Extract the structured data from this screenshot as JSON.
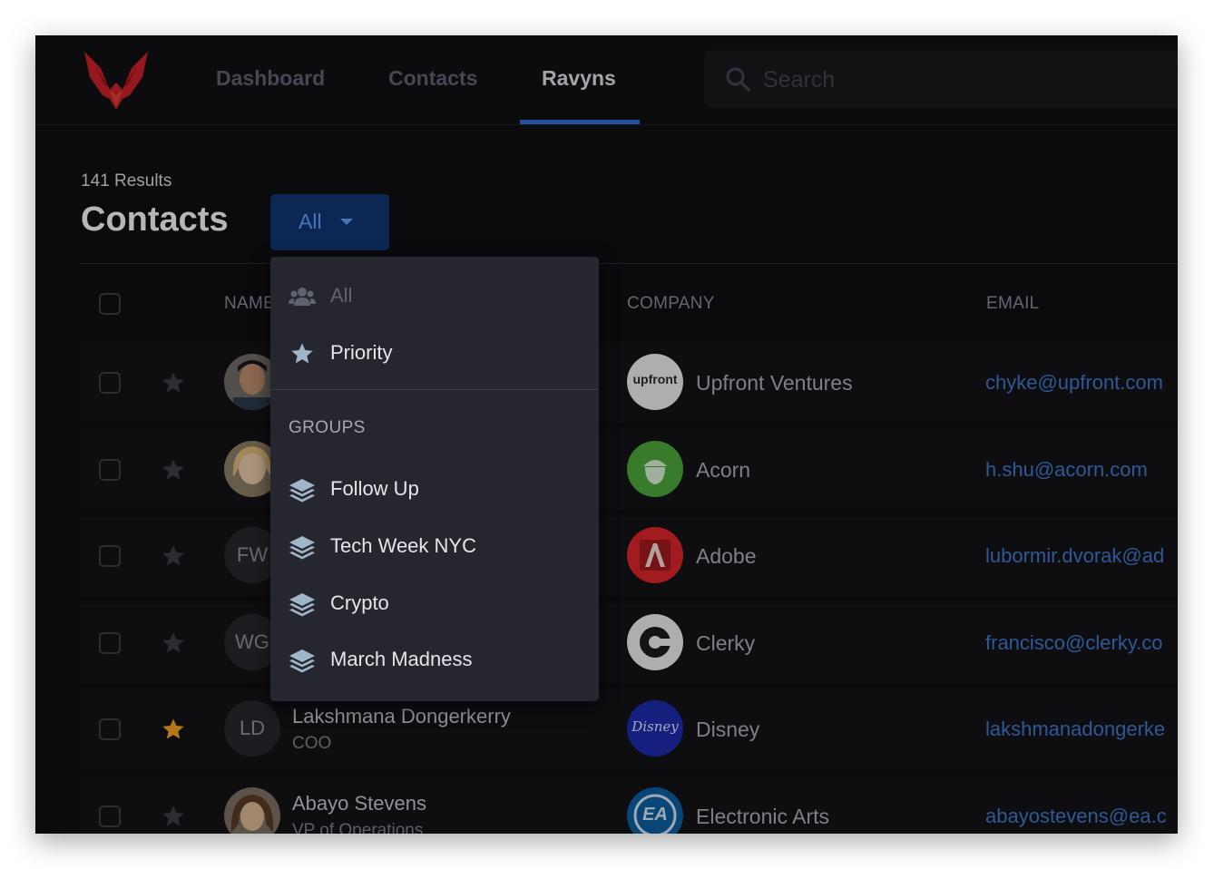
{
  "nav": {
    "tabs": [
      {
        "label": "Dashboard"
      },
      {
        "label": "Contacts"
      },
      {
        "label": "Ravyns"
      }
    ],
    "active_tab": "Ravyns",
    "search_placeholder": "Search"
  },
  "header": {
    "results_count": "141 Results",
    "title": "Contacts",
    "filter_label": "All"
  },
  "columns": {
    "name": "NAME",
    "company": "COMPANY",
    "email": "EMAIL"
  },
  "rows": [
    {
      "initials": "",
      "name": "",
      "title": "",
      "company": "Upfront Ventures",
      "company_logo_text": "upfront",
      "email": "chyke@upfront.com",
      "starred": false
    },
    {
      "initials": "",
      "name": "",
      "title": "",
      "company": "Acorn",
      "company_logo_text": "",
      "email": "h.shu@acorn.com",
      "starred": false
    },
    {
      "initials": "FW",
      "name": "",
      "title": "",
      "company": "Adobe",
      "company_logo_text": "",
      "email": "lubormir.dvorak@ad",
      "starred": false
    },
    {
      "initials": "WG",
      "name": "",
      "title": "",
      "company": "Clerky",
      "company_logo_text": "",
      "email": "francisco@clerky.co",
      "starred": false
    },
    {
      "initials": "LD",
      "name": "Lakshmana Dongerkerry",
      "title": "COO",
      "company": "Disney",
      "company_logo_text": "Disney",
      "email": "lakshmanadongerke",
      "starred": true
    },
    {
      "initials": "",
      "name": "Abayo Stevens",
      "title": "VP of Operations",
      "company": "Electronic Arts",
      "company_logo_text": "EA",
      "email": "abayostevens@ea.c",
      "starred": false
    }
  ],
  "dropdown": {
    "all_label": "All",
    "priority_label": "Priority",
    "groups_header": "GROUPS",
    "groups": [
      {
        "label": "Follow Up"
      },
      {
        "label": "Tech Week NYC"
      },
      {
        "label": "Crypto"
      },
      {
        "label": "March Madness"
      }
    ]
  },
  "colors": {
    "accent": "#2f6fd6",
    "filter_button": "#123572",
    "star_active": "#f0a020",
    "email_link": "#3f76c8",
    "background": "#0f0f12"
  }
}
